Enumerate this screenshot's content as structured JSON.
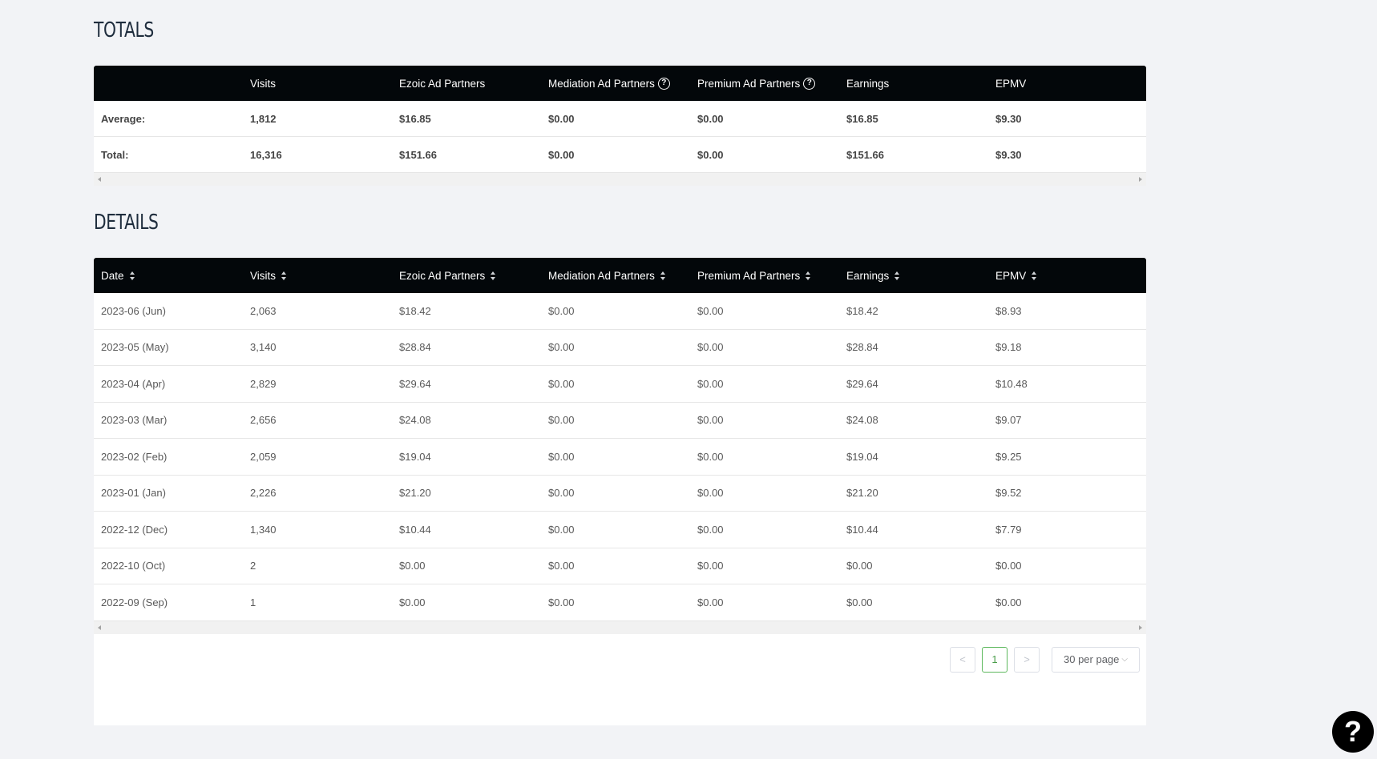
{
  "totals": {
    "title": "TOTALS",
    "columns": [
      "",
      "Visits",
      "Ezoic Ad Partners",
      "Mediation Ad Partners",
      "Premium Ad Partners",
      "Earnings",
      "EPMV"
    ],
    "rows": [
      [
        "Average:",
        "1,812",
        "$16.85",
        "$0.00",
        "$0.00",
        "$16.85",
        "$9.30"
      ],
      [
        "Total:",
        "16,316",
        "$151.66",
        "$0.00",
        "$0.00",
        "$151.66",
        "$9.30"
      ]
    ]
  },
  "details": {
    "title": "DETAILS",
    "columns": [
      "Date",
      "Visits",
      "Ezoic Ad Partners",
      "Mediation Ad Partners",
      "Premium Ad Partners",
      "Earnings",
      "EPMV"
    ],
    "rows": [
      [
        "2023-06 (Jun)",
        "2,063",
        "$18.42",
        "$0.00",
        "$0.00",
        "$18.42",
        "$8.93"
      ],
      [
        "2023-05 (May)",
        "3,140",
        "$28.84",
        "$0.00",
        "$0.00",
        "$28.84",
        "$9.18"
      ],
      [
        "2023-04 (Apr)",
        "2,829",
        "$29.64",
        "$0.00",
        "$0.00",
        "$29.64",
        "$10.48"
      ],
      [
        "2023-03 (Mar)",
        "2,656",
        "$24.08",
        "$0.00",
        "$0.00",
        "$24.08",
        "$9.07"
      ],
      [
        "2023-02 (Feb)",
        "2,059",
        "$19.04",
        "$0.00",
        "$0.00",
        "$19.04",
        "$9.25"
      ],
      [
        "2023-01 (Jan)",
        "2,226",
        "$21.20",
        "$0.00",
        "$0.00",
        "$21.20",
        "$9.52"
      ],
      [
        "2022-12 (Dec)",
        "1,340",
        "$10.44",
        "$0.00",
        "$0.00",
        "$10.44",
        "$7.79"
      ],
      [
        "2022-10 (Oct)",
        "2",
        "$0.00",
        "$0.00",
        "$0.00",
        "$0.00",
        "$0.00"
      ],
      [
        "2022-09 (Sep)",
        "1",
        "$0.00",
        "$0.00",
        "$0.00",
        "$0.00",
        "$0.00"
      ]
    ]
  },
  "pagination": {
    "prev": "<",
    "current_page": "1",
    "next": ">",
    "page_size": "30 per page",
    "chevron": "⌵"
  },
  "help_fab": {
    "label": "?"
  },
  "icons": {
    "help": "help-circle-icon",
    "sort": "sort-caret-icon",
    "scroll_left": "scroll-left-arrow-icon",
    "scroll_right": "scroll-right-arrow-icon"
  },
  "colors": {
    "header_bg": "#03070a",
    "page_bg": "#f2f3f6",
    "active_page": "#5cb85c"
  }
}
